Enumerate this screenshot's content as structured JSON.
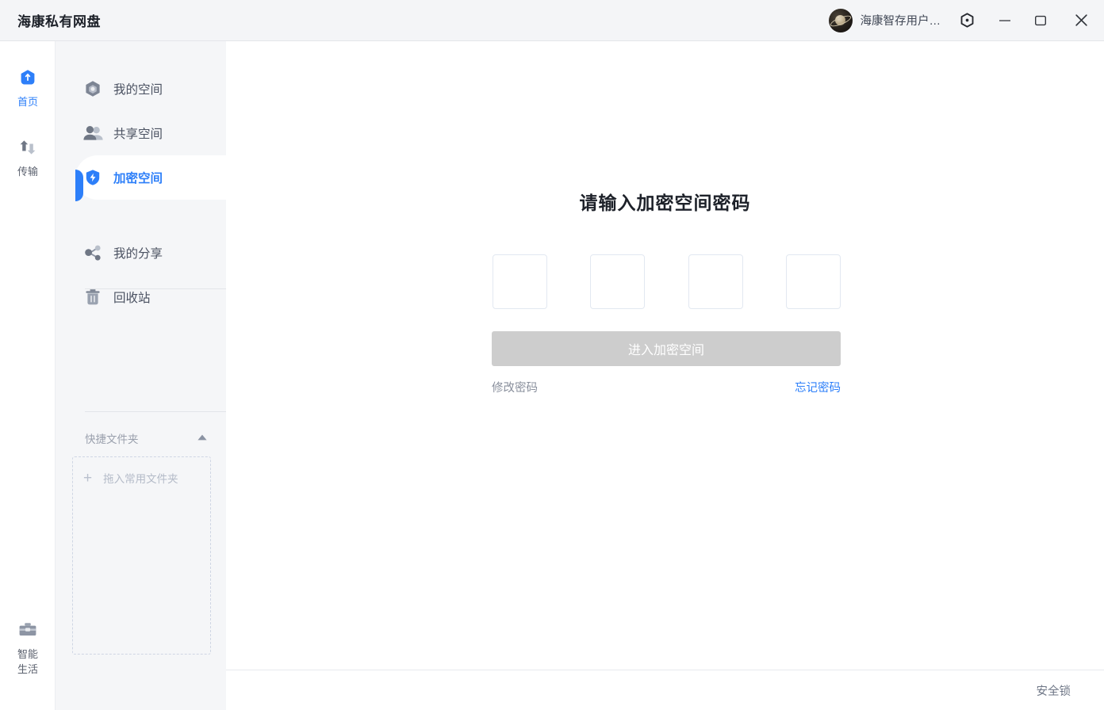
{
  "window": {
    "title": "海康私有网盘",
    "user_name": "海康智存用户…",
    "avatar_icon": "planet-avatar",
    "settings_icon": "hex-gear-icon",
    "minimize_icon": "minimize-icon",
    "maximize_icon": "maximize-icon",
    "close_icon": "close-icon"
  },
  "rail": {
    "items": [
      {
        "label": "首页",
        "icon": "home-shield-icon",
        "active": true
      },
      {
        "label": "传输",
        "icon": "transfer-arrows-icon",
        "active": false
      },
      {
        "label": "智能\n生活",
        "label_line1": "智能",
        "label_line2": "生活",
        "icon": "toolbox-icon",
        "active": false
      }
    ]
  },
  "sidebar": {
    "group_one": [
      {
        "label": "我的空间",
        "icon": "cube-icon",
        "active": false
      },
      {
        "label": "共享空间",
        "icon": "people-icon",
        "active": false
      },
      {
        "label": "加密空间",
        "icon": "shield-lock-icon",
        "active": true
      }
    ],
    "group_two": [
      {
        "label": "我的分享",
        "icon": "share-nodes-icon",
        "active": false
      },
      {
        "label": "回收站",
        "icon": "trash-icon",
        "active": false
      }
    ],
    "quick_folder": {
      "title": "快捷文件夹",
      "collapse_icon": "chevron-up-icon",
      "dropzone_plus": "+",
      "dropzone_text": "拖入常用文件夹"
    }
  },
  "main": {
    "title": "请输入加密空间密码",
    "pin_boxes": [
      "",
      "",
      "",
      ""
    ],
    "enter_button": "进入加密空间",
    "change_password_link": "修改密码",
    "forgot_password_link": "忘记密码"
  },
  "statusbar": {
    "security_lock": "安全锁"
  },
  "colors": {
    "accent": "#2d7ff9",
    "header_bg": "#f4f5f7",
    "sidebar_bg": "#f5f6f8",
    "disabled_button": "#cdcdcd",
    "muted_text": "#8a909d",
    "pin_border": "#e2e8f1"
  }
}
